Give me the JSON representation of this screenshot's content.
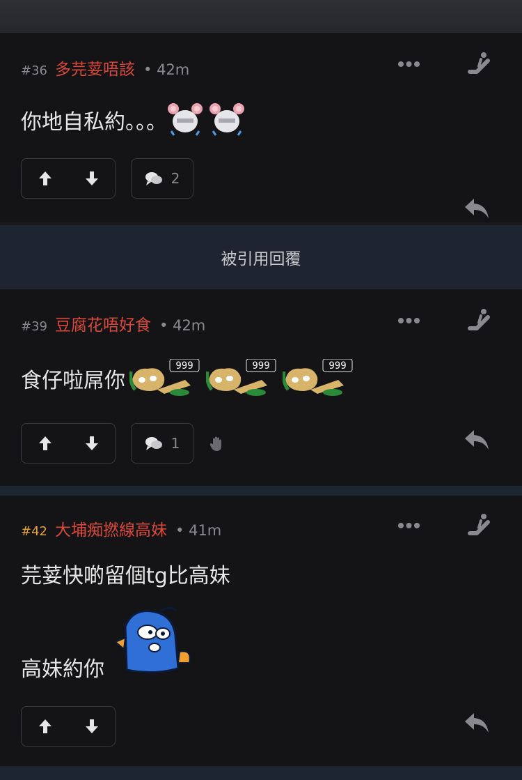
{
  "posts": [
    {
      "number": "#36",
      "username": "多芫荽唔該",
      "time": "42m",
      "content": "你地自私約。。。",
      "comment_count": "2",
      "stickers": [
        "mouse-crying-emoji",
        "mouse-crying-emoji"
      ]
    },
    {
      "number": "#39",
      "username": "豆腐花唔好食",
      "time": "42m",
      "content": "食仔啦屌你",
      "comment_count": "1",
      "stickers": [
        "dog-phone-emoji",
        "dog-phone-emoji",
        "dog-phone-emoji"
      ],
      "sticker_text": "999"
    },
    {
      "number": "#42",
      "username": "大埔痴撚線高妹",
      "time": "41m",
      "content_line1": "芫荽快啲留個tg比高妹",
      "content_line2": "高妹約你",
      "sticker": "blue-penguin-sticker"
    }
  ],
  "quoted_replies": {
    "label": "被引用回覆"
  },
  "separator": "•",
  "colors": {
    "username": "#d9483b",
    "post_number_highlight": "#e6a532",
    "background": "#141416",
    "muted": "#8a8a8e"
  }
}
